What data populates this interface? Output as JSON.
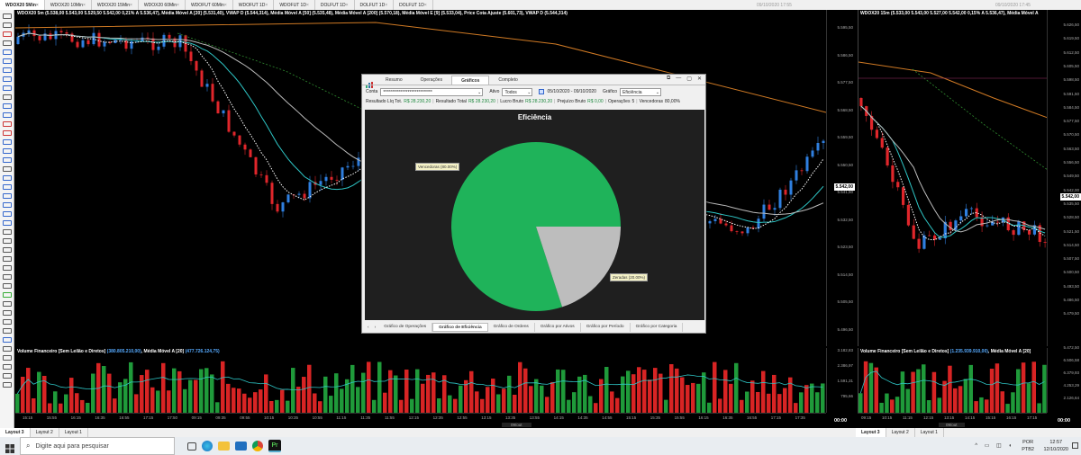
{
  "top_tabs": [
    "WDOX20 5Min",
    "WDOX20 10Min",
    "WDOX20 15Min",
    "WDOX20 60Min",
    "WDOFUT 60Min",
    "WDOFUT 1D",
    "WDOFUT 1D",
    "DOLFUT 1D",
    "DOLFUT 1D",
    "DOLFUT 1D"
  ],
  "top_timestamp": "09/10/2020 17:55",
  "top_timestamp_right": "09/10/2020 17:45",
  "left_chart": {
    "title": "WDOX20 5m (5.538,00 5.543,00 5.529,50 5.542,00 0,21% A 5.536,47), Média Móvel A [20] (5.531,40), VWAP D (5.544,314), Média Móvel A [50] (5.535,48), Média Móvel A [200] (5.570,18), Média Móvel E [9] (5.533,04), Price Cota Ajuste (5.601,73), VWAP D (5.544,314)",
    "y_labels": [
      "5.595,50",
      "5.586,50",
      "5.577,50",
      "5.568,50",
      "5.559,50",
      "5.550,50",
      "5.541,50",
      "5.532,50",
      "5.523,50",
      "5.514,50",
      "5.505,50",
      "5.496,50"
    ],
    "last_price": "5.542,00",
    "volume_title": "Volume Financeiro [Sem Leilão e Diretos]",
    "volume_value": "(380.805.210,00)",
    "volume_ma": ", Média Móvel A [20]",
    "volume_ma_value": "(477.726.124,75)",
    "vol_y_labels": [
      "3.182,83",
      "2.386,97",
      "1.591,31",
      "795,66"
    ],
    "x_labels": [
      "15:15",
      "15:55",
      "16:15",
      "16:35",
      "16:55",
      "17:15",
      "17:50",
      "09:15",
      "09:35",
      "09:55",
      "10:15",
      "10:35",
      "10:55",
      "11:15",
      "11:35",
      "11:55",
      "12:15",
      "12:35",
      "12:55",
      "13:15",
      "13:35",
      "13:55",
      "14:15",
      "14:35",
      "14:55",
      "15:15",
      "15:35",
      "15:55",
      "16:15",
      "16:35",
      "16:55",
      "17:15",
      "17:35"
    ],
    "x_day_label": "09/out",
    "time_box": "00:00"
  },
  "right_chart": {
    "title": "WDOX20 15m (5.533,00 5.543,00 5.527,00 5.542,00 0,15% A 5.536,47), Média Móvel A",
    "y_labels": [
      "5.626,50",
      "5.619,50",
      "5.612,50",
      "5.605,50",
      "5.598,50",
      "5.591,50",
      "5.584,50",
      "5.577,50",
      "5.570,50",
      "5.563,50",
      "5.556,50",
      "5.549,50",
      "5.542,00",
      "5.535,50",
      "5.528,50",
      "5.521,50",
      "5.514,50",
      "5.507,50",
      "5.500,50",
      "5.493,50",
      "5.486,50",
      "5.479,50"
    ],
    "last_price": "5.542,00",
    "volume_title": "Volume Financeiro [Sem Leilão e Diretos]",
    "volume_value": "(1.235.939.910,00)",
    "volume_ma": ", Média Móvel A [20]",
    "vol_y_labels": [
      "5.472,50",
      "6.506,58",
      "6.379,93",
      "4.253,29",
      "2.126,64"
    ],
    "x_labels": [
      "09:15",
      "10:15",
      "11:15",
      "12:15",
      "13:15",
      "14:15",
      "15:15",
      "16:15",
      "17:15"
    ],
    "x_day_label": "09/out",
    "time_box": "00:00"
  },
  "bottom_tabs": {
    "left": [
      "Layout 3",
      "Layout 2",
      "Layout 1"
    ],
    "right": [
      "Layout 3",
      "Layout 2",
      "Layout 1"
    ]
  },
  "taskbar": {
    "search_placeholder": "Digite aqui para pesquisar",
    "lang_top": "POR",
    "lang_bottom": "PTB2",
    "time": "12:57",
    "date": "12/10/2020"
  },
  "dialog": {
    "tabs": [
      "Resumo",
      "Operações",
      "Gráficos",
      "Completo"
    ],
    "active_tab": "Gráficos",
    "filter": {
      "conta_label": "Conta",
      "conta_value": "****************************",
      "ativo_label": "Ativo",
      "ativo_value": "Todos",
      "date_range": "05/10/2020 - 09/10/2020",
      "grafico_label": "Gráfico",
      "grafico_value": "Eficiência"
    },
    "stats": {
      "liq_label": "Resultado Líq Tot.",
      "liq_value": "R$ 28.230,20",
      "total_label": "Resultado Total",
      "total_value": "R$ 28.230,20",
      "bruto_label": "Lucro Bruto",
      "bruto_value": "R$ 28.230,20",
      "prejuizo_label": "Prejuízo Bruto",
      "prejuizo_value": "R$ 0,00",
      "ops_label": "Operações",
      "ops_value": "5",
      "venc_label": "Vencedoras",
      "venc_value": "80,00%"
    },
    "bottom_tabs": [
      "Gráfico de Operações",
      "Gráfico de Eficiência",
      "Gráfico de Ordens",
      "Gráfico por Ativos",
      "Gráfico por Período",
      "Gráfico por Categoria"
    ],
    "active_bottom": "Gráfico de Eficiência"
  },
  "chart_data": {
    "type": "pie",
    "title": "Eficiência",
    "slices": [
      {
        "label": "Vencedoras (80.00%)",
        "value": 80,
        "color": "#1fb35a"
      },
      {
        "label": "Zeradas (20.00%)",
        "value": 20,
        "color": "#bdbdbd"
      }
    ]
  },
  "colors": {
    "up": "#2f7fe0",
    "down": "#e0262b",
    "vol_up": "#1f9a3a",
    "vol_down": "#d82424"
  }
}
